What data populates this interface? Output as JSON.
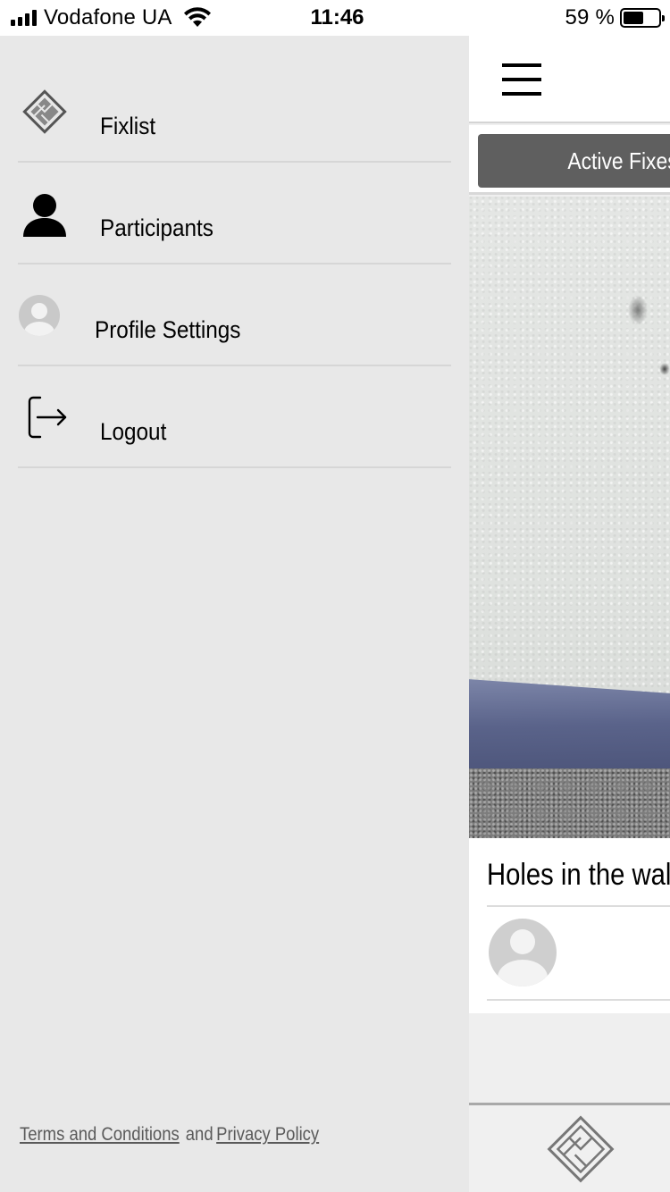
{
  "status_bar": {
    "carrier": "Vodafone UA",
    "time": "11:46",
    "battery": "59 %",
    "battery_level": 0.59,
    "icons": [
      "signal-icon",
      "wifi-icon",
      "battery-icon"
    ]
  },
  "drawer": {
    "menu": [
      {
        "label": "Fixlist",
        "icon": "fixlist-logo-icon"
      },
      {
        "label": "Participants",
        "icon": "person-icon"
      },
      {
        "label": "Profile Settings",
        "icon": "avatar-icon"
      },
      {
        "label": "Logout",
        "icon": "logout-icon"
      }
    ],
    "footer": {
      "terms": "Terms and Conditions",
      "and": "and",
      "privacy": "Privacy Policy"
    }
  },
  "main": {
    "menu_icon": "hamburger-icon",
    "active_tab": "Active Fixes",
    "card": {
      "title": "Holes in the wall"
    },
    "bottom_nav_icon": "fixlist-logo-icon"
  },
  "colors": {
    "drawer_bg": "#e8e8e8",
    "tab_active_bg": "#5f5f5f",
    "link_color": "#5a5a5a"
  }
}
